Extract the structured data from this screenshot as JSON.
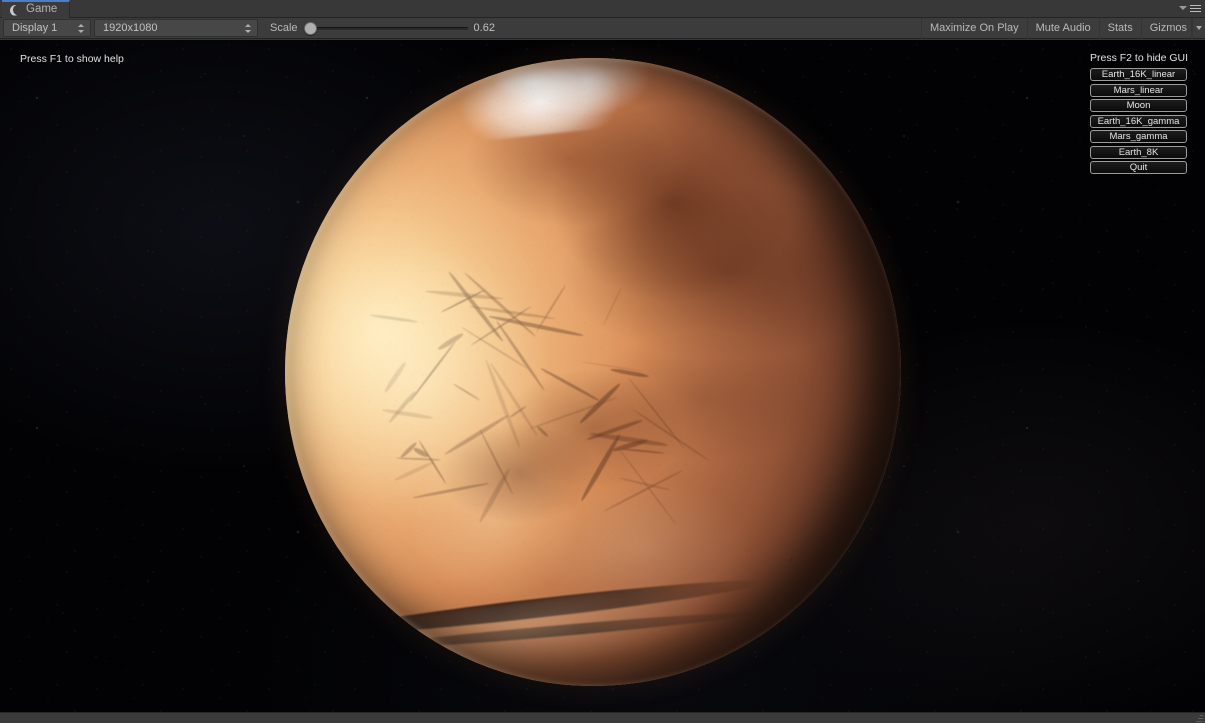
{
  "window": {
    "tab_label": "Game",
    "tab_icon": "game-controller-icon",
    "menu_icon": "tab-menu-icon"
  },
  "toolbar": {
    "display_select": "Display 1",
    "resolution_select": "1920x1080",
    "scale_label": "Scale",
    "scale_value": "0.62",
    "maximize_on_play": "Maximize On Play",
    "mute_audio": "Mute Audio",
    "stats": "Stats",
    "gizmos": "Gizmos"
  },
  "game": {
    "hint_left": "Press F1 to show help",
    "hint_right": "Press F2 to hide GUI",
    "buttons": [
      {
        "label": "Earth_16K_linear"
      },
      {
        "label": "Mars_linear"
      },
      {
        "label": "Moon"
      },
      {
        "label": "Earth_16K_gamma"
      },
      {
        "label": "Mars_gamma"
      },
      {
        "label": "Earth_8K"
      },
      {
        "label": "Quit"
      }
    ],
    "scene": {
      "body": "Mars",
      "background": "starfield"
    }
  },
  "colors": {
    "accent_tab": "#4f7cc9",
    "editor_chrome": "#3c3c3c",
    "viewport_background": "#030305",
    "planet_light": "#ffe9b4",
    "planet_mid": "#c2744a",
    "planet_shadow": "#2a130e"
  }
}
